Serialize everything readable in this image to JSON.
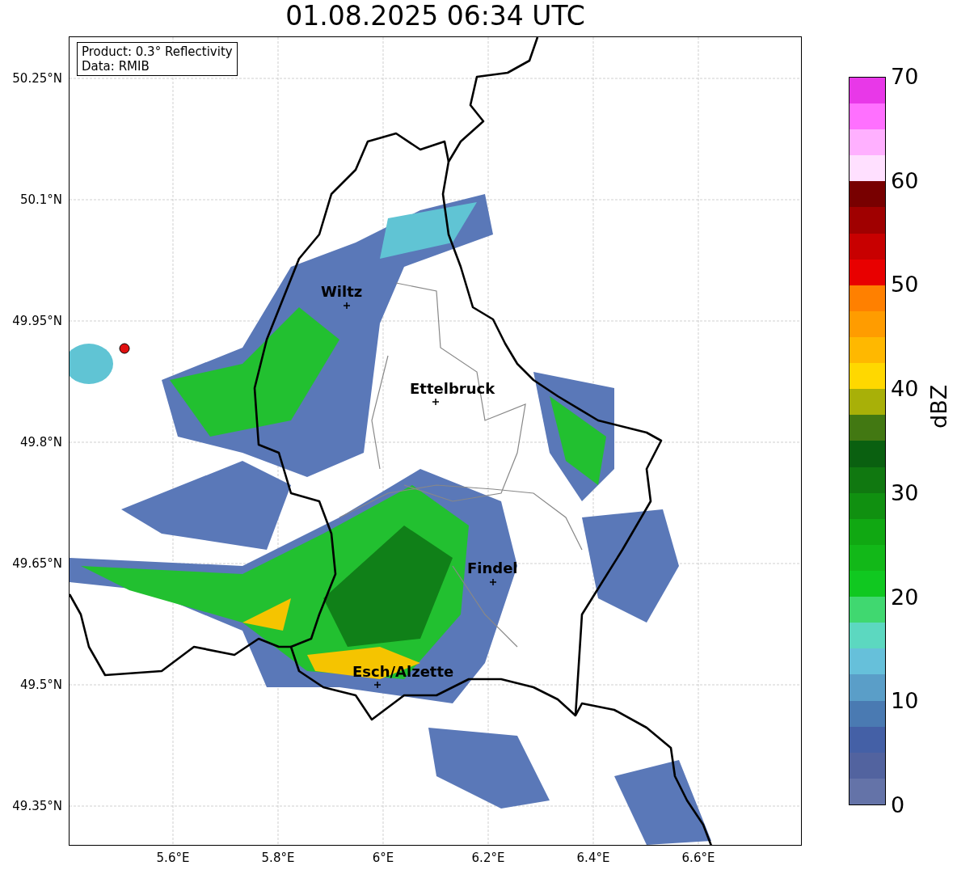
{
  "title": "01.08.2025 06:34 UTC",
  "info_box": [
    "Product: 0.3° Reflectivity",
    "Data: RMIB"
  ],
  "map": {
    "y_ticks": [
      "50.25°N",
      "50.1°N",
      "49.95°N",
      "49.8°N",
      "49.65°N",
      "49.5°N",
      "49.35°N"
    ],
    "x_ticks": [
      "5.6°E",
      "5.8°E",
      "6°E",
      "6.2°E",
      "6.4°E",
      "6.6°E"
    ],
    "places": [
      {
        "name": "Wiltz"
      },
      {
        "name": "Ettelbruck"
      },
      {
        "name": "Findel"
      },
      {
        "name": "Esch/Alzette"
      }
    ]
  },
  "colorbar": {
    "label": "dBZ",
    "ticks": [
      "70",
      "60",
      "50",
      "40",
      "30",
      "20",
      "10",
      "0"
    ],
    "bands": [
      {
        "color": "#6473a8"
      },
      {
        "color": "#52639f"
      },
      {
        "color": "#4460a6"
      },
      {
        "color": "#4a7ab2"
      },
      {
        "color": "#5a9ec8"
      },
      {
        "color": "#66c0da"
      },
      {
        "color": "#5cd8c0"
      },
      {
        "color": "#40d870"
      },
      {
        "color": "#10c820"
      },
      {
        "color": "#12b818"
      },
      {
        "color": "#10a812"
      },
      {
        "color": "#109010"
      },
      {
        "color": "#107810"
      },
      {
        "color": "#0a6010"
      },
      {
        "color": "#427812"
      },
      {
        "color": "#a8b008"
      },
      {
        "color": "#ffd800"
      },
      {
        "color": "#ffb800"
      },
      {
        "color": "#ff9c00"
      },
      {
        "color": "#ff8000"
      },
      {
        "color": "#e80000"
      },
      {
        "color": "#c80000"
      },
      {
        "color": "#a00000"
      },
      {
        "color": "#780000"
      },
      {
        "color": "#ffe0ff"
      },
      {
        "color": "#ffb0ff"
      },
      {
        "color": "#ff70ff"
      },
      {
        "color": "#e838e8"
      }
    ]
  }
}
